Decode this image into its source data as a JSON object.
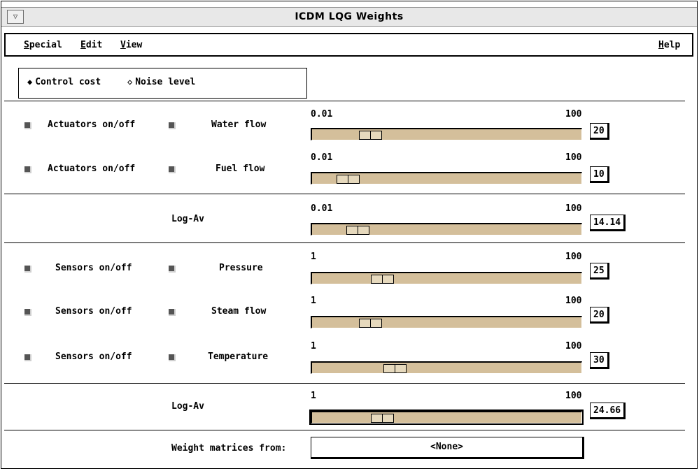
{
  "window": {
    "title": "ICDM LQG Weights",
    "menu_button": "▽"
  },
  "menubar": {
    "special": {
      "hot": "S",
      "rest": "pecial"
    },
    "edit": {
      "hot": "E",
      "rest": "dit"
    },
    "view": {
      "hot": "V",
      "rest": "iew"
    },
    "help": {
      "hot": "H",
      "rest": "elp"
    }
  },
  "mode": {
    "control_cost": "Control cost",
    "noise_level": "Noise level",
    "selected": "control_cost"
  },
  "actuators": [
    {
      "group_label": "Actuators on/off",
      "name": "Water flow",
      "min": "0.01",
      "max": "100",
      "value": "20",
      "level": 0.19
    },
    {
      "group_label": "Actuators on/off",
      "name": "Fuel flow",
      "min": "0.01",
      "max": "100",
      "value": "10",
      "level": 0.1
    }
  ],
  "actuator_logav": {
    "label": "Log-Av",
    "min": "0.01",
    "max": "100",
    "value": "14.14",
    "level": 0.14
  },
  "sensors": [
    {
      "group_label": "Sensors on/off",
      "name": "Pressure",
      "min": "1",
      "max": "100",
      "value": "25",
      "level": 0.24
    },
    {
      "group_label": "Sensors on/off",
      "name": "Steam flow",
      "min": "1",
      "max": "100",
      "value": "20",
      "level": 0.19
    },
    {
      "group_label": "Sensors on/off",
      "name": "Temperature",
      "min": "1",
      "max": "100",
      "value": "30",
      "level": 0.29
    }
  ],
  "sensor_logav": {
    "label": "Log-Av",
    "min": "1",
    "max": "100",
    "value": "24.66",
    "level": 0.24
  },
  "weight_matrices": {
    "label": "Weight matrices from:",
    "value": "<None>"
  },
  "colors": {
    "slider_trough": "#d4bf9b",
    "slider_thumb": "#e6d9bd"
  }
}
